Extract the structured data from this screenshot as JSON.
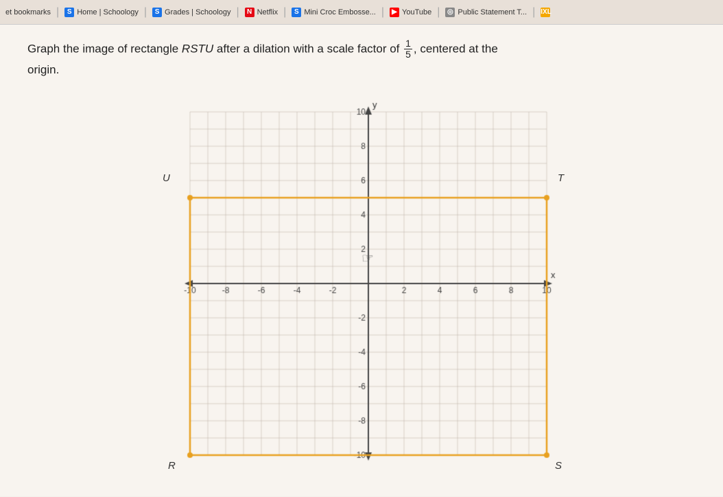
{
  "browser": {
    "bookmarks_label": "et bookmarks",
    "tabs": [
      {
        "label": "Home | Schoology",
        "favicon": "S",
        "type": "s"
      },
      {
        "label": "Grades | Schoology",
        "favicon": "S",
        "type": "s"
      },
      {
        "label": "Netflix",
        "favicon": "N",
        "type": "n"
      },
      {
        "label": "Mini Croc Embosse...",
        "favicon": "S",
        "type": "s"
      },
      {
        "label": "YouTube",
        "favicon": "▶",
        "type": "yt"
      },
      {
        "label": "Public Statement T...",
        "favicon": "◎",
        "type": "pub"
      },
      {
        "label": "IXL",
        "favicon": "IXL",
        "type": "ixl"
      }
    ]
  },
  "problem": {
    "text_before": "Graph the image of rectangle ",
    "shape": "RSTU",
    "text_middle": " after a dilation with a scale factor of ",
    "fraction": {
      "numerator": "1",
      "denominator": "5"
    },
    "text_after": ", centered at the origin."
  },
  "graph": {
    "x_min": -10,
    "x_max": 10,
    "y_min": -10,
    "y_max": 10,
    "rectangle": {
      "corners": {
        "R": [
          -10,
          -10
        ],
        "S": [
          10,
          -10
        ],
        "T": [
          10,
          5
        ],
        "U": [
          -10,
          5
        ]
      },
      "color": "#e8a020"
    },
    "axes": {
      "color": "#555",
      "grid_color": "#c8bfb4"
    },
    "labels": {
      "U": "U",
      "T": "T",
      "R": "R",
      "S": "S"
    }
  }
}
